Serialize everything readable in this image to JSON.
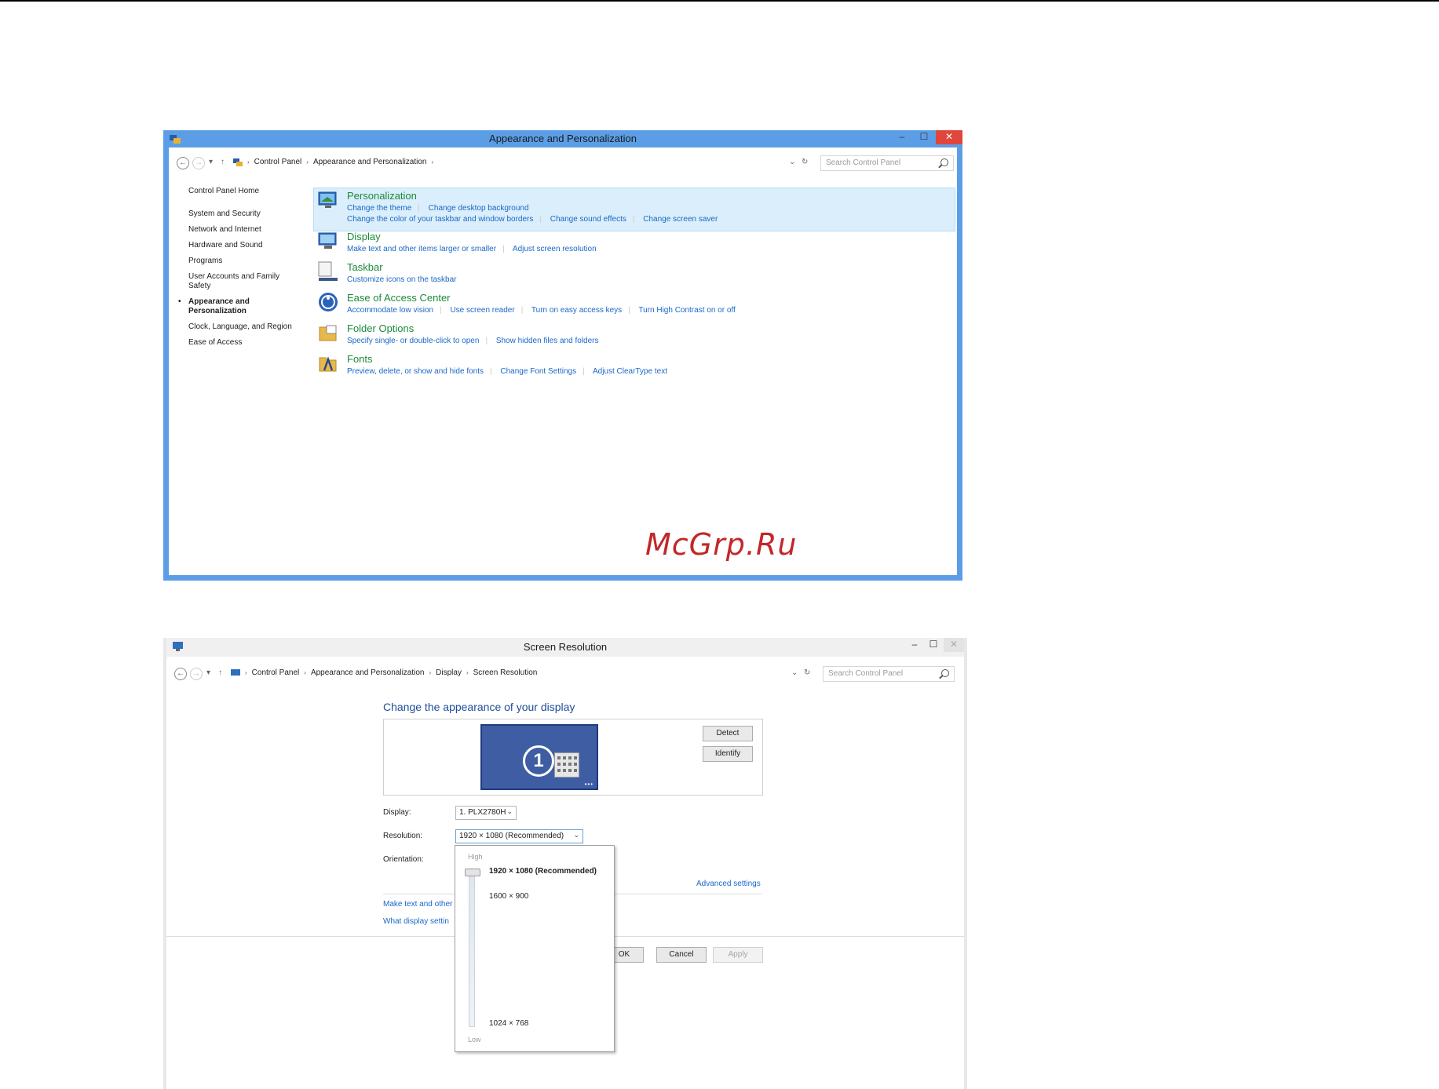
{
  "window1": {
    "title": "Appearance and Personalization",
    "breadcrumbs": [
      "Control Panel",
      "Appearance and Personalization"
    ],
    "search_placeholder": "Search Control Panel",
    "sidebar": {
      "home": "Control Panel Home",
      "items": [
        "System and Security",
        "Network and Internet",
        "Hardware and Sound",
        "Programs",
        "User Accounts and Family Safety",
        "Appearance and Personalization",
        "Clock, Language, and Region",
        "Ease of Access"
      ],
      "active_index": 5
    },
    "categories": [
      {
        "title": "Personalization",
        "icon": "personalization-icon",
        "links": [
          "Change the theme",
          "Change desktop background"
        ],
        "links2": [
          "Change the color of your taskbar and window borders",
          "Change sound effects",
          "Change screen saver"
        ]
      },
      {
        "title": "Display",
        "icon": "display-icon",
        "links": [
          "Make text and other items larger or smaller",
          "Adjust screen resolution"
        ]
      },
      {
        "title": "Taskbar",
        "icon": "taskbar-icon",
        "links": [
          "Customize icons on the taskbar"
        ]
      },
      {
        "title": "Ease of Access Center",
        "icon": "ease-of-access-icon",
        "links": [
          "Accommodate low vision",
          "Use screen reader",
          "Turn on easy access keys",
          "Turn High Contrast on or off"
        ]
      },
      {
        "title": "Folder Options",
        "icon": "folder-options-icon",
        "links": [
          "Specify single- or double-click to open",
          "Show hidden files and folders"
        ]
      },
      {
        "title": "Fonts",
        "icon": "fonts-icon",
        "links": [
          "Preview, delete, or show and hide fonts",
          "Change Font Settings",
          "Adjust ClearType text"
        ]
      }
    ]
  },
  "watermark": "McGrp.Ru",
  "window2": {
    "title": "Screen Resolution",
    "breadcrumbs": [
      "Control Panel",
      "Appearance and Personalization",
      "Display",
      "Screen Resolution"
    ],
    "search_placeholder": "Search Control Panel",
    "heading": "Change the appearance of your display",
    "monitor_number": "1",
    "detect_label": "Detect",
    "identify_label": "Identify",
    "display_label": "Display:",
    "display_value": "1. PLX2780H",
    "resolution_label": "Resolution:",
    "resolution_value": "1920 × 1080 (Recommended)",
    "orientation_label": "Orientation:",
    "advanced_settings": "Advanced settings",
    "link_make_text": "Make text and other",
    "link_what_display": "What display settin",
    "ok_label": "OK",
    "cancel_label": "Cancel",
    "apply_label": "Apply",
    "dropdown": {
      "high_label": "High",
      "low_label": "Low",
      "options": [
        "1920 × 1080 (Recommended)",
        "1600 × 900",
        "1024 × 768"
      ],
      "selected_index": 0
    }
  }
}
